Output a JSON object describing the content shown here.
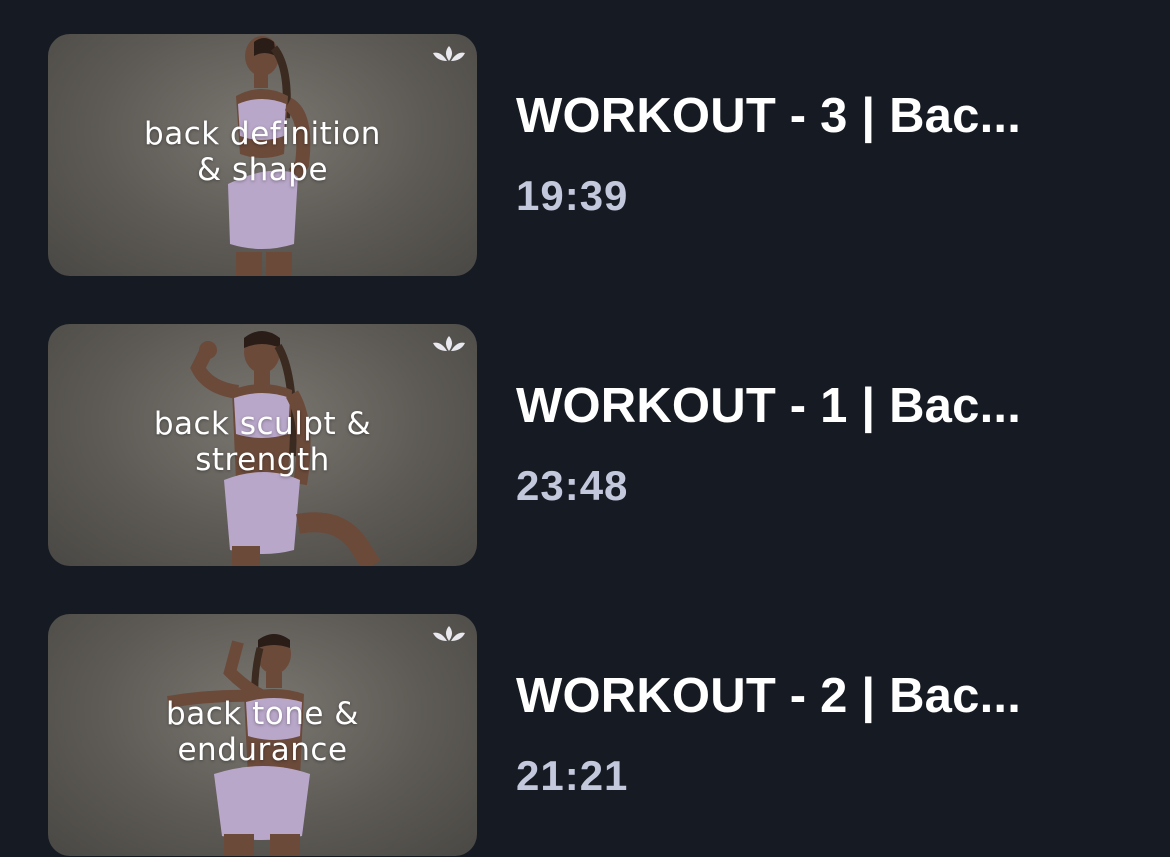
{
  "workouts": [
    {
      "thumbnail_caption": "back definition & shape",
      "caption_line1": "back definition",
      "caption_line2": "& shape",
      "title": "WORKOUT - 3 | Bac...",
      "duration": "19:39",
      "icon": "lotus-icon"
    },
    {
      "thumbnail_caption": "back sculpt & strength",
      "caption_line1": "back sculpt &",
      "caption_line2": "strength",
      "title": "WORKOUT - 1 | Bac...",
      "duration": "23:48",
      "icon": "lotus-icon"
    },
    {
      "thumbnail_caption": "back tone & endurance",
      "caption_line1": "back tone &",
      "caption_line2": "endurance",
      "title": "WORKOUT - 2 | Bac...",
      "duration": "21:21",
      "icon": "lotus-icon"
    }
  ],
  "colors": {
    "background": "#161a22",
    "title": "#ffffff",
    "duration": "#c4c8dc",
    "outfit": "#b9a7c9"
  }
}
